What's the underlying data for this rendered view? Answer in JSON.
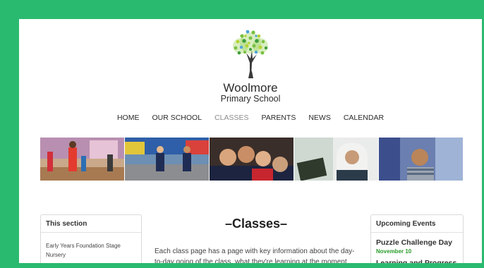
{
  "brand": {
    "name_line1": "Woolmore",
    "name_line2": "Primary School",
    "logo_icon": "tree-logo-icon"
  },
  "nav": {
    "items": [
      "HOME",
      "OUR SCHOOL",
      "CLASSES",
      "PARENTS",
      "NEWS",
      "CALENDAR"
    ],
    "active": "CLASSES"
  },
  "banner": {
    "photos": [
      "children-running-hall",
      "children-running-playground",
      "girls-smiling-group",
      "girl-hijab-reading",
      "boy-smiling-portrait"
    ]
  },
  "sidebar": {
    "title": "This section",
    "items": [
      "Early Years Foundation Stage",
      "Nursery"
    ]
  },
  "main": {
    "heading": "–Classes–",
    "text": "Each class page has a page with key information about  the day-to-day going of the class, what they're learning at the moment"
  },
  "events": {
    "title": "Upcoming Events",
    "items": [
      {
        "title": "Puzzle Challenge Day",
        "date": "November 10"
      },
      {
        "title": "Learning and Progress",
        "date": ""
      }
    ]
  },
  "colors": {
    "frame": "#2aba6f",
    "event_date": "#2a9b2a",
    "nav_active": "#8d8d8d"
  }
}
